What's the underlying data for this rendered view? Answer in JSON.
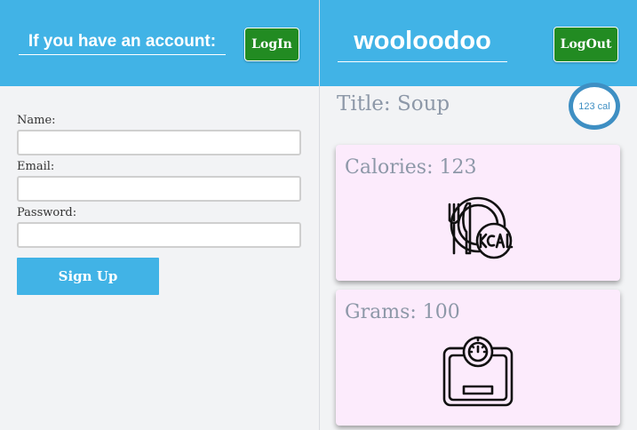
{
  "left": {
    "header": {
      "account_prompt": "If you have an account:",
      "login_label": "LogIn"
    },
    "form": {
      "name_label": "Name:",
      "name_value": "",
      "email_label": "Email:",
      "email_value": "",
      "password_label": "Password:",
      "password_value": "",
      "signup_label": "Sign Up"
    }
  },
  "right": {
    "header": {
      "brand": "wooloodoo",
      "logout_label": "LogOut"
    },
    "title": "Title: Soup",
    "calorie_badge": "123 cal",
    "cards": [
      {
        "label": "Calories: 123",
        "icon": "kcal-plate-icon"
      },
      {
        "label": "Grams: 100",
        "icon": "weighing-scale-icon"
      }
    ]
  },
  "colors": {
    "header_blue": "#41b3e6",
    "button_green": "#228b22",
    "card_pink": "#fcebfc",
    "badge_blue": "#3e8fc3",
    "muted_text": "#8d98a8"
  }
}
